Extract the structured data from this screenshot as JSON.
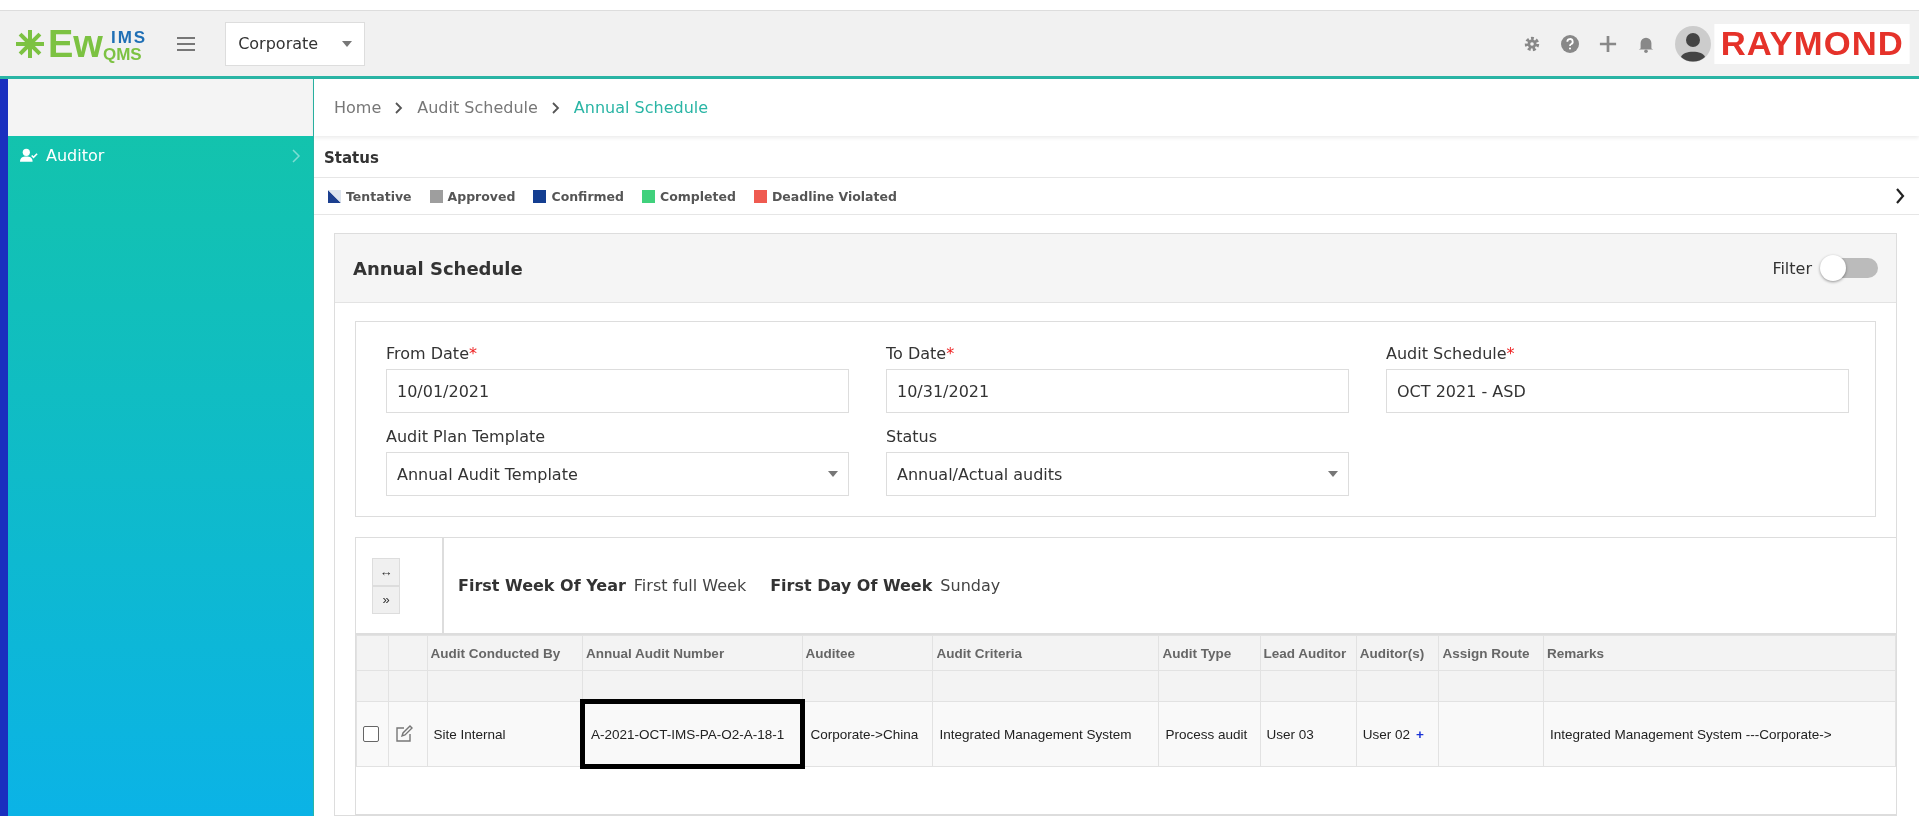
{
  "header": {
    "logo": {
      "main": "Ew",
      "super": "IMS",
      "sub": "QMS"
    },
    "site_select": {
      "value": "Corporate"
    },
    "brand": "RAYMOND"
  },
  "sidebar": {
    "items": [
      {
        "label": "Auditor",
        "selected": false
      }
    ]
  },
  "breadcrumb": [
    {
      "label": "Home",
      "current": false
    },
    {
      "label": "Audit Schedule",
      "current": false
    },
    {
      "label": "Annual Schedule",
      "current": true
    }
  ],
  "status": {
    "title": "Status",
    "legend": [
      {
        "label": "Tentative",
        "kind": "triangle",
        "color": "#1b3f8f"
      },
      {
        "label": "Approved",
        "kind": "square",
        "color": "#9e9e9e"
      },
      {
        "label": "Confirmed",
        "kind": "square",
        "color": "#143e91"
      },
      {
        "label": "Completed",
        "kind": "square",
        "color": "#40d17c"
      },
      {
        "label": "Deadline Violated",
        "kind": "square",
        "color": "#ef5a50"
      }
    ]
  },
  "panel": {
    "title": "Annual Schedule",
    "filter": {
      "label": "Filter",
      "on": false
    },
    "fields": [
      {
        "label": "From Date",
        "required_mark": "*",
        "value": "10/01/2021",
        "kind": "text"
      },
      {
        "label": "To Date",
        "required_mark": "*",
        "value": "10/31/2021",
        "kind": "text"
      },
      {
        "label": "Audit Schedule",
        "required_mark": "*",
        "value": "OCT 2021 - ASD",
        "kind": "text"
      },
      {
        "label": "Audit Plan Template",
        "value": "Annual Audit Template",
        "kind": "select"
      },
      {
        "label": "Status",
        "value": "Annual/Actual audits",
        "kind": "select"
      }
    ]
  },
  "table": {
    "tools": [
      "↔",
      "»"
    ],
    "info": [
      {
        "label": "First Week Of Year",
        "value": "First full Week"
      },
      {
        "label": "First Day Of Week",
        "value": "Sunday"
      }
    ],
    "columns": [
      "Audit Conducted By",
      "Annual Audit Number",
      "Auditee",
      "Audit Criteria",
      "Audit Type",
      "Lead Auditor",
      "Auditor(s)",
      "Assign Route",
      "Remarks"
    ],
    "rows": [
      {
        "checked": false,
        "cells": [
          {
            "text": "Site Internal",
            "outlined": false
          },
          {
            "text": "A-2021-OCT-IMS-PA-O2-A-18-1",
            "outlined": true
          },
          {
            "text": "Corporate->China",
            "outlined": false
          },
          {
            "text": "Integrated Management System",
            "outlined": false
          },
          {
            "text": "Process audit",
            "outlined": false
          },
          {
            "text": "User 03",
            "outlined": false
          },
          {
            "text": "User 02",
            "action": "+",
            "outlined": false
          },
          {
            "text": "",
            "outlined": false
          },
          {
            "text": "Integrated Management System ---Corporate->",
            "outlined": false
          }
        ]
      }
    ]
  }
}
